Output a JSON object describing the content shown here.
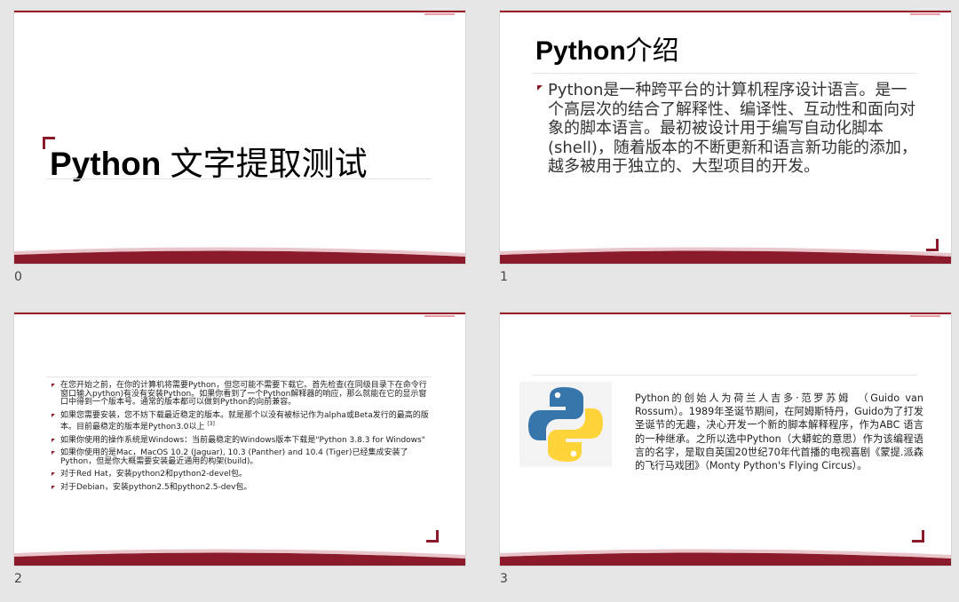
{
  "slides": [
    {
      "number": "0",
      "title_latin": "Python",
      "title_cn": " 文字提取测试"
    },
    {
      "number": "1",
      "title_latin": "Python",
      "title_cn": "介绍",
      "body": "Python是一种跨平台的计算机程序设计语言。是一个高层次的结合了解释性、编译性、互动性和面向对象的脚本语言。最初被设计用于编写自动化脚本(shell)，随着版本的不断更新和语言新功能的添加，越多被用于独立的、大型项目的开发。"
    },
    {
      "number": "2",
      "bullets": [
        "在您开始之前，在你的计算机将需要Python，但您可能不需要下载它。首先检查(在同级目录下在命令行窗口输入python)有没有安装Python。如果你看到了一个Python解释器的响应，那么就能在它的显示窗口中得到一个版本号。通常的版本都可以做到Python的向前兼容。",
        "如果您需要安装，您不妨下载最近稳定的版本。就是那个以没有被标记作为alpha或Beta发行的最高的版本。目前最稳定的版本是Python3.0以上",
        "如果你使用的操作系统是Windows：当前最稳定的Windows版本下载是\"Python 3.8.3 for Windows\"",
        "如果你使用的是Mac，MacOS 10.2 (Jaguar), 10.3 (Panther) and 10.4 (Tiger)已经集成安装了Python，但是你大概需要安装最近通用的构架(build)。",
        "对于Red Hat，安装python2和python2-devel包。",
        "对于Debian，安装python2.5和python2.5-dev包。"
      ],
      "footnote": "[3]"
    },
    {
      "number": "3",
      "body": "Python的创始人为荷兰人吉多·范罗苏姆　（Guido van Rossum）。1989年圣诞节期间，在阿姆斯特丹，Guido为了打发圣诞节的无趣，决心开发一个新的脚本解释程序，作为ABC 语言的一种继承。之所以选中Python（大蟒蛇的意思）作为该编程语言的名字，是取自英国20世纪70年代首播的电视喜剧《蒙提.派森的飞行马戏团》（Monty Python's Flying Circus）。",
      "logo_icon": "python-logo-icon",
      "logo_colors": {
        "blue": "#3776ab",
        "yellow": "#ffd43b"
      }
    }
  ],
  "theme": {
    "accent": "#8b1a2a",
    "background": "#e6e6e6"
  }
}
